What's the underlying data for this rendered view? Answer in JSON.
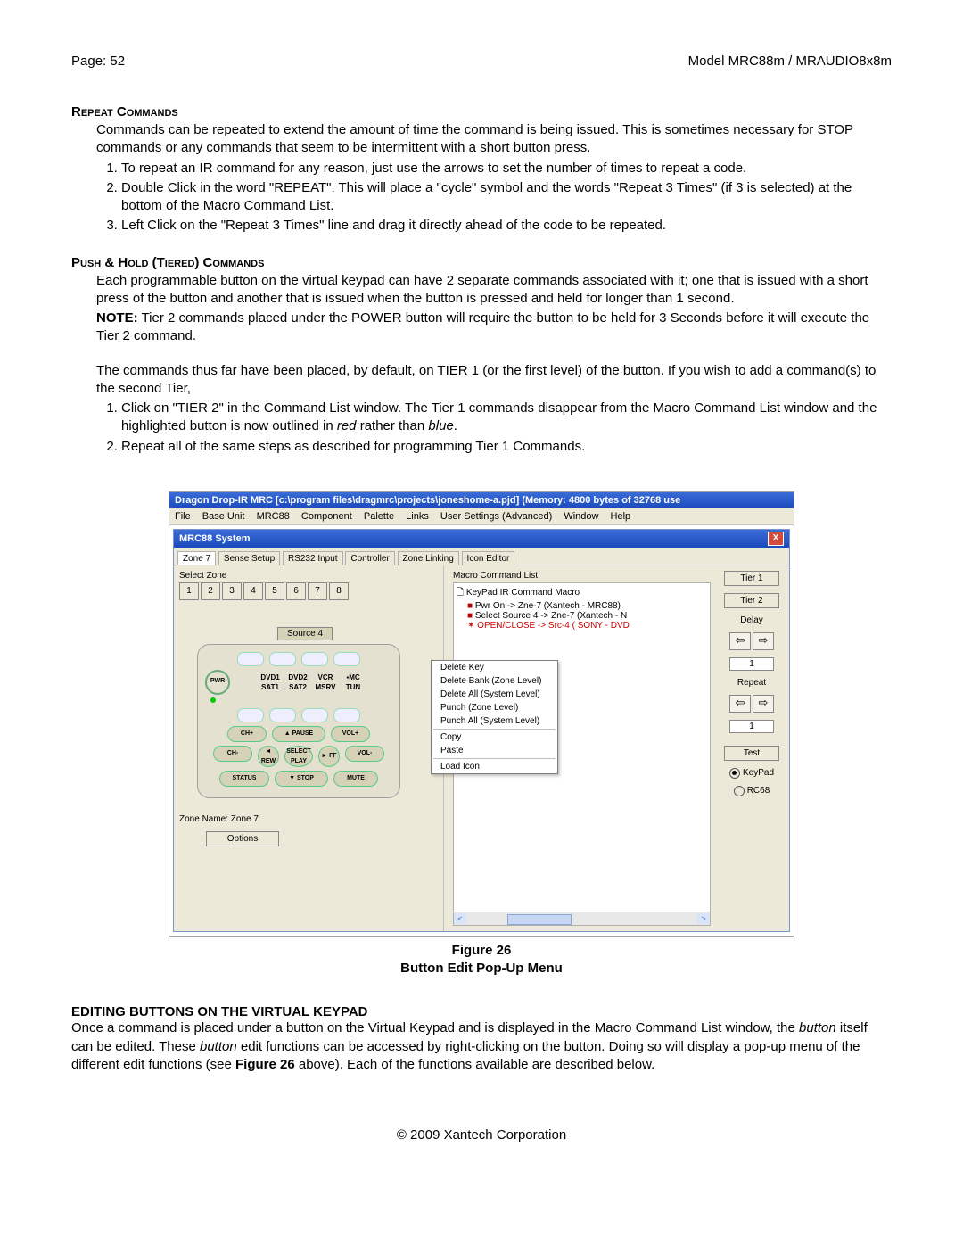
{
  "header": {
    "page": "Page: 52",
    "model": "Model MRC88m / MRAUDIO8x8m"
  },
  "sec1": {
    "title": "Repeat Commands",
    "p1": "Commands can be repeated to extend the amount of time the command is being issued. This is sometimes necessary for STOP commands or any commands that seem to be intermittent with a short button press.",
    "li1": "To repeat an IR command for any reason, just use the arrows to set the number of times to repeat a code.",
    "li2": "Double Click in the word \"REPEAT\". This will place a \"cycle\" symbol and the words \"Repeat 3 Times\" (if 3 is selected) at the bottom of the Macro Command List.",
    "li3": "Left Click on the \"Repeat 3 Times\" line and drag it directly ahead of the code to be repeated."
  },
  "sec2": {
    "title": "Push & Hold (Tiered) Commands",
    "p1": "Each programmable button on the virtual keypad can have 2 separate commands associated with it; one that is issued with a short press of the button and another that is issued when the button is pressed and held for longer than 1 second.",
    "note": "NOTE:",
    "noteText": " Tier 2 commands placed under the POWER button will require the button to be held for 3 Seconds before it will execute the Tier 2 command.",
    "p2": "The commands thus far have been placed, by default, on TIER 1 (or the first level) of the button. If you wish to add a command(s) to the second Tier,",
    "li1a": "Click on \"TIER 2\" in the Command List window. The Tier 1 commands disappear from the Macro Command List window and the highlighted button is now outlined in ",
    "li1red": "red",
    "li1mid": " rather than ",
    "li1blue": "blue",
    "li1end": ".",
    "li2": "Repeat all of the same steps as described for programming Tier 1 Commands."
  },
  "screenshot": {
    "title": "Dragon Drop-IR MRC [c:\\program files\\dragmrc\\projects\\joneshome-a.pjd] (Memory: 4800 bytes of 32768 use",
    "menus": [
      "File",
      "Base Unit",
      "MRC88",
      "Component",
      "Palette",
      "Links",
      "User Settings (Advanced)",
      "Window",
      "Help"
    ],
    "innerTitle": "MRC88 System",
    "tabs": [
      "Zone 7",
      "Sense Setup",
      "RS232 Input",
      "Controller",
      "Zone Linking",
      "Icon Editor"
    ],
    "activeTab": 0,
    "selectZone": "Select Zone",
    "zones": [
      "1",
      "2",
      "3",
      "4",
      "5",
      "6",
      "7",
      "8"
    ],
    "sourceBtn": "Source 4",
    "kp": {
      "row1": [
        "DVD1",
        "DVD2",
        "VCR",
        "▪MC"
      ],
      "row2": [
        "SAT1",
        "SAT2",
        "MSRV",
        "TUN"
      ],
      "pwr": "PWR",
      "chp": "CH+",
      "chm": "CH-",
      "pause": "▲ PAUSE",
      "rew": "◄\nREW",
      "play": "SELECT\nPLAY",
      "ff": "►\nFF",
      "volp": "VOL+",
      "volm": "VOL-",
      "status": "STATUS",
      "stop": "▼ STOP",
      "mute": "MUTE"
    },
    "zoneName": "Zone Name: Zone 7",
    "options": "Options",
    "macroHeader": "Macro Command List",
    "macro": {
      "l1": "KeyPad IR Command Macro",
      "l2": "Pwr On -> Zne-7 (Xantech - MRC88)",
      "l3": "Select Source 4 -> Zne-7 (Xantech - N",
      "l4": "OPEN/CLOSE -> Src-4 ( SONY - DVD"
    },
    "tier1": "Tier 1",
    "tier2": "Tier 2",
    "delay": "Delay",
    "repeat": "Repeat",
    "val1": "1",
    "test": "Test",
    "radio1": "KeyPad",
    "radio2": "RC68",
    "popup": [
      "Delete Key",
      "Delete Bank (Zone Level)",
      "Delete All (System Level)",
      "Punch (Zone Level)",
      "Punch All (System Level)",
      "Copy",
      "Paste",
      "Load Icon"
    ]
  },
  "figcap": {
    "l1": "Figure 26",
    "l2": "Button Edit Pop-Up Menu"
  },
  "sec3": {
    "title": "EDITING BUTTONS ON THE VIRTUAL KEYPAD",
    "p1a": "Once a command is placed under a button on the Virtual Keypad and is displayed in the Macro Command List window, the ",
    "i1": "button",
    "p1b": " itself can be edited. These ",
    "i2": "button",
    "p1c": " edit functions can be accessed by right-clicking on the button. Doing so will display a pop-up menu of the different edit functions (see ",
    "b1": "Figure 26",
    "p1d": " above). Each of the functions available are described below."
  },
  "footer": "© 2009 Xantech Corporation"
}
